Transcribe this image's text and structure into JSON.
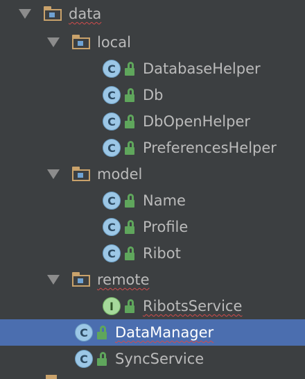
{
  "tree": {
    "data_folder": "data",
    "local_folder": "local",
    "local_items": [
      "DatabaseHelper",
      "Db",
      "DbOpenHelper",
      "PreferencesHelper"
    ],
    "model_folder": "model",
    "model_items": [
      "Name",
      "Profile",
      "Ribot"
    ],
    "remote_folder": "remote",
    "remote_items": [
      "RibotsService"
    ],
    "data_items": [
      "DataManager",
      "SyncService"
    ],
    "class_badge": "C",
    "interface_badge": "I"
  },
  "icons": {
    "folder": "package-folder-icon",
    "class": "class-icon",
    "interface": "interface-icon",
    "access": "open-lock-icon",
    "expand": "expanded-arrow-icon"
  },
  "colors": {
    "background": "#3c3f41",
    "selection": "#4b6eaf",
    "folder": "#c9a26b",
    "class": "#9cc7e6",
    "interface": "#a6d99b",
    "lock": "#5fa65c",
    "error_underline": "#d24c4c"
  }
}
